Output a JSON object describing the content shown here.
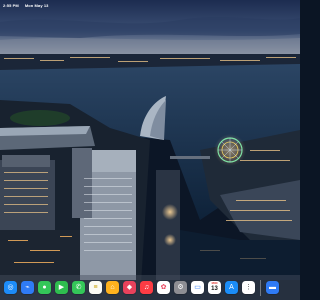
{
  "status_bar": {
    "time": "2:55 PM",
    "date": "Mon May 13"
  },
  "dock": {
    "apps": [
      {
        "name": "Safari",
        "glyph": "◎",
        "bg": "#1d8cf8",
        "fg": "#ffffff"
      },
      {
        "name": "Messenger",
        "glyph": "⌁",
        "bg": "#2f7bf6",
        "fg": "#ffffff"
      },
      {
        "name": "Messages",
        "glyph": "●",
        "bg": "#34c759",
        "fg": "#ffffff"
      },
      {
        "name": "FaceTime",
        "glyph": "▶",
        "bg": "#2fbe4f",
        "fg": "#ffffff"
      },
      {
        "name": "Phone",
        "glyph": "✆",
        "bg": "#34c759",
        "fg": "#ffffff"
      },
      {
        "name": "Notes",
        "glyph": "≡",
        "bg": "#fbfbf4",
        "fg": "#c8a000"
      },
      {
        "name": "Home",
        "glyph": "⌂",
        "bg": "#ffb21e",
        "fg": "#ffffff"
      },
      {
        "name": "Shortcuts",
        "glyph": "◆",
        "bg": "#e8425c",
        "fg": "#ffffff"
      },
      {
        "name": "Music",
        "glyph": "♫",
        "bg": "#fc3c44",
        "fg": "#ffffff"
      },
      {
        "name": "Photos",
        "glyph": "✿",
        "bg": "#ffffff",
        "fg": "#e8425c"
      },
      {
        "name": "Settings",
        "glyph": "⚙",
        "bg": "#8e8e93",
        "fg": "#ffffff"
      },
      {
        "name": "Files",
        "glyph": "▭",
        "bg": "#ffffff",
        "fg": "#2f7bf6"
      },
      {
        "name": "Calendar",
        "day": "MON",
        "date": "13"
      },
      {
        "name": "App Store",
        "glyph": "A",
        "bg": "#1b8df7",
        "fg": "#ffffff"
      },
      {
        "name": "Reminders",
        "glyph": "⋮",
        "bg": "#ffffff",
        "fg": "#555555"
      }
    ],
    "extra": [
      {
        "name": "Folder",
        "glyph": "▬",
        "bg": "#2f7bf6",
        "fg": "#ffffff"
      }
    ]
  },
  "colors": {
    "sky_top": "#1a2a4e",
    "sky_horizon": "#b8b8b6",
    "water": "#0f2a44",
    "city_lights": "#f2c98a"
  }
}
